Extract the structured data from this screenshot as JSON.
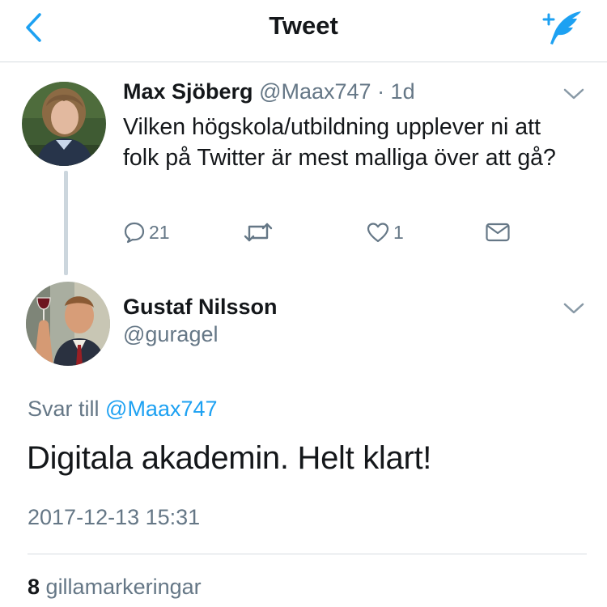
{
  "nav": {
    "title": "Tweet",
    "back_icon": "chevron-left-icon",
    "compose_icon": "compose-tweet-icon",
    "accent_color": "#1da1f2"
  },
  "parent_tweet": {
    "author_name": "Max Sjöberg",
    "author_handle": "@Maax747",
    "time_ago": "· 1d",
    "text": "Vilken högskola/utbildning upplever ni att folk på Twitter är mest malliga över att gå?",
    "reply_count": "21",
    "retweet_count": "",
    "like_count": "1"
  },
  "reply_tweet": {
    "author_name": "Gustaf Nilsson",
    "author_handle": "@guragel",
    "reply_prefix": "Svar till",
    "reply_to_handle": "@Maax747",
    "text": "Digitala akademin. Helt klart!",
    "timestamp": "2017-12-13 15:31",
    "likes_count": "8",
    "likes_label": "gillamarkeringar"
  },
  "colors": {
    "text_primary": "#14171a",
    "text_secondary": "#657786",
    "link": "#1da1f2",
    "divider": "#d6dce0"
  }
}
